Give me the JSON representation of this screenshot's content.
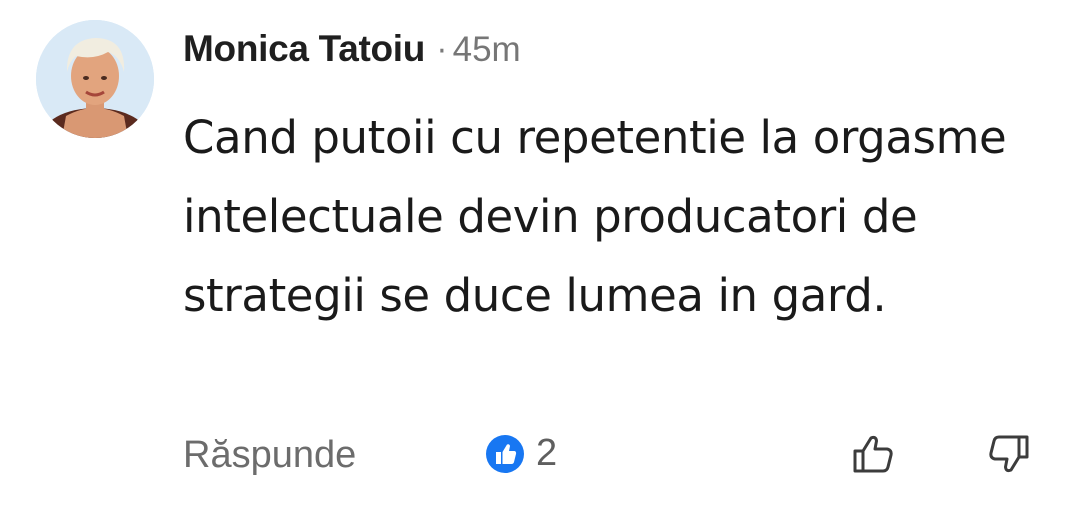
{
  "comment": {
    "author": "Monica Tatoiu",
    "separator": "·",
    "time": "45m",
    "text": "Cand putoii cu repetentie la orgasme intelectuale devin producatori de strategii se duce lumea in gard."
  },
  "actions": {
    "reply_label": "Răspunde",
    "like_count": "2",
    "thumbs_up_icon": "thumbs-up-outline",
    "thumbs_down_icon": "thumbs-down-outline"
  },
  "colors": {
    "like_badge": "#1877F2",
    "secondary_text": "#6c6c6c"
  }
}
